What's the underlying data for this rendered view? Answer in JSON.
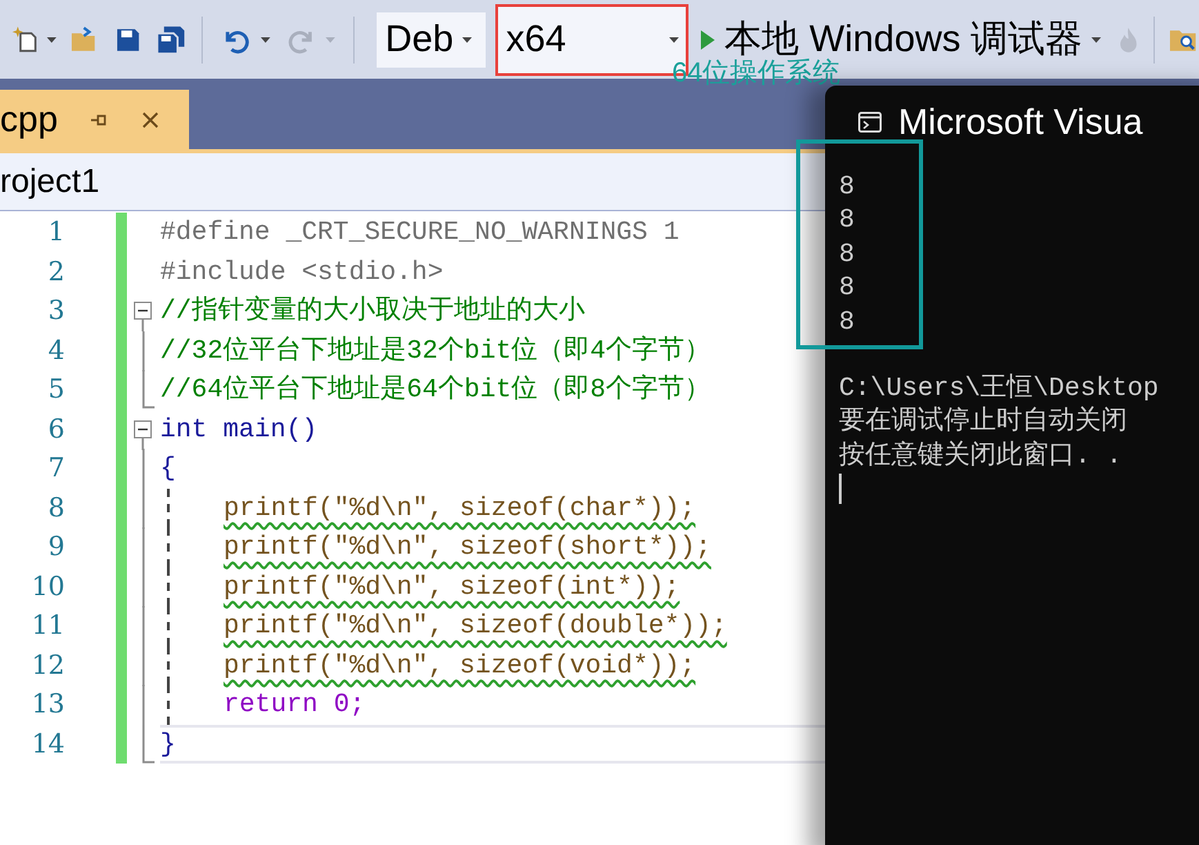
{
  "toolbar": {
    "configuration": {
      "value": "Deb"
    },
    "platform": {
      "value": "x64",
      "marked": true
    },
    "run": {
      "label": "本地 Windows 调试器"
    },
    "redo_disabled": true
  },
  "annotation": {
    "text": "64位操作系统"
  },
  "tab": {
    "label": "cpp",
    "selected": true
  },
  "navigation": {
    "project": "roject1"
  },
  "lines": [
    {
      "number": "1",
      "changed": true,
      "kind": "preprocessor",
      "text": "#define _CRT_SECURE_NO_WARNINGS 1"
    },
    {
      "number": "2",
      "changed": true,
      "kind": "preprocessor",
      "text": "#include <stdio.h>"
    },
    {
      "number": "3",
      "changed": true,
      "collapsible": true,
      "kind": "comment",
      "text": "//指针变量的大小取决于地址的大小"
    },
    {
      "number": "4",
      "changed": true,
      "outline": true,
      "kind": "comment",
      "text": "//32位平台下地址是32个bit位（即4个字节）"
    },
    {
      "number": "5",
      "changed": true,
      "outline_end": true,
      "kind": "comment",
      "text": "//64位平台下地址是64个bit位（即8个字节）"
    },
    {
      "number": "6",
      "changed": true,
      "collapsible": true,
      "kind": "code",
      "text": "int main()"
    },
    {
      "number": "7",
      "changed": true,
      "outline": true,
      "kind": "code",
      "text": "{"
    },
    {
      "number": "8",
      "changed": true,
      "outline": true,
      "indent_guide": true,
      "warning": true,
      "kind": "call",
      "text": "printf(\"%d\\n\", sizeof(char*));"
    },
    {
      "number": "9",
      "changed": true,
      "outline": true,
      "indent_guide": true,
      "warning": true,
      "kind": "call",
      "text": "printf(\"%d\\n\", sizeof(short*));"
    },
    {
      "number": "10",
      "changed": true,
      "outline": true,
      "indent_guide": true,
      "warning": true,
      "kind": "call",
      "text": "printf(\"%d\\n\", sizeof(int*));"
    },
    {
      "number": "11",
      "changed": true,
      "outline": true,
      "indent_guide": true,
      "warning": true,
      "kind": "call",
      "text": "printf(\"%d\\n\", sizeof(double*));"
    },
    {
      "number": "12",
      "changed": true,
      "outline": true,
      "indent_guide": true,
      "warning": true,
      "kind": "call",
      "text": "printf(\"%d\\n\", sizeof(void*));"
    },
    {
      "number": "13",
      "changed": true,
      "outline": true,
      "indent_guide": true,
      "kind": "statement",
      "text": "return 0;"
    },
    {
      "number": "14",
      "changed": true,
      "outline_end": true,
      "current": true,
      "kind": "code",
      "text": "}"
    }
  ],
  "console": {
    "title": "Microsoft Visua",
    "output": {
      "marked": true,
      "lines": [
        "8",
        "8",
        "8",
        "8",
        "8"
      ]
    },
    "messages": [
      "C:\\Users\\王恒\\Desktop",
      "要在调试停止时自动关闭",
      "按任意键关闭此窗口. ."
    ],
    "cursor": true
  }
}
